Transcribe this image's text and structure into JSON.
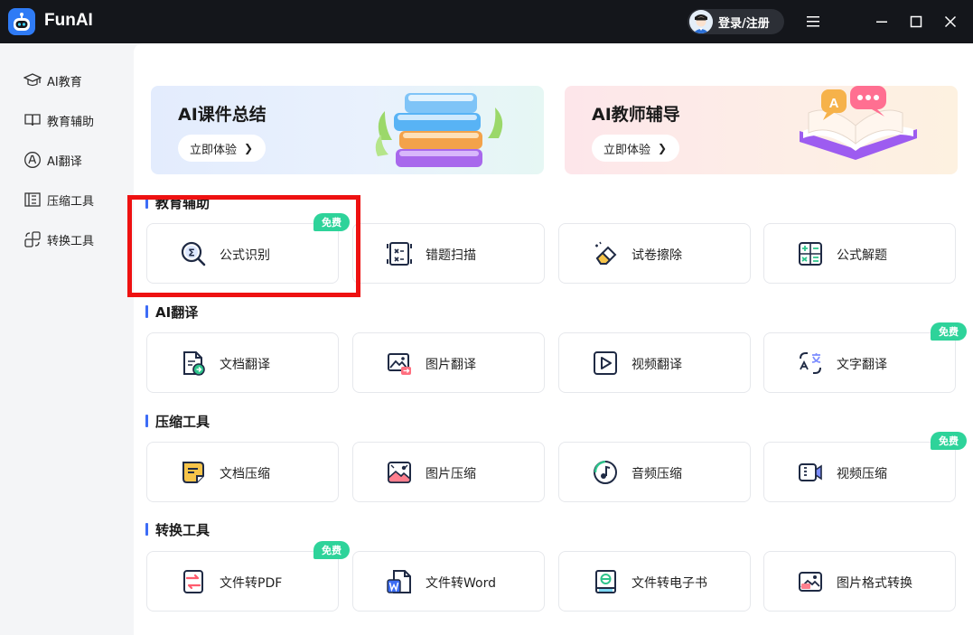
{
  "app": {
    "title": "FunAI"
  },
  "header": {
    "login_label": "登录/注册"
  },
  "sidebar": {
    "items": [
      {
        "label": "AI教育",
        "icon": "graduation-cap-icon"
      },
      {
        "label": "教育辅助",
        "icon": "book-icon"
      },
      {
        "label": "AI翻译",
        "icon": "translate-icon"
      },
      {
        "label": "压缩工具",
        "icon": "compress-icon"
      },
      {
        "label": "转换工具",
        "icon": "convert-icon"
      }
    ]
  },
  "banners": [
    {
      "title": "AI课件总结",
      "button": "立即体验"
    },
    {
      "title": "AI教师辅导",
      "button": "立即体验"
    }
  ],
  "sections": [
    {
      "title": "教育辅助",
      "cards": [
        {
          "label": "公式识别",
          "icon": "formula-search-icon",
          "badge": "免费"
        },
        {
          "label": "错题扫描",
          "icon": "scan-icon"
        },
        {
          "label": "试卷擦除",
          "icon": "eraser-icon"
        },
        {
          "label": "公式解题",
          "icon": "calculator-icon"
        }
      ]
    },
    {
      "title": "AI翻译",
      "cards": [
        {
          "label": "文档翻译",
          "icon": "document-translate-icon"
        },
        {
          "label": "图片翻译",
          "icon": "image-translate-icon"
        },
        {
          "label": "视频翻译",
          "icon": "video-translate-icon"
        },
        {
          "label": "文字翻译",
          "icon": "text-translate-icon",
          "badge": "免费"
        }
      ]
    },
    {
      "title": "压缩工具",
      "cards": [
        {
          "label": "文档压缩",
          "icon": "document-compress-icon"
        },
        {
          "label": "图片压缩",
          "icon": "image-compress-icon"
        },
        {
          "label": "音频压缩",
          "icon": "audio-compress-icon"
        },
        {
          "label": "视频压缩",
          "icon": "video-compress-icon",
          "badge": "免费"
        }
      ]
    },
    {
      "title": "转换工具",
      "cards": [
        {
          "label": "文件转PDF",
          "icon": "pdf-convert-icon",
          "badge": "免费"
        },
        {
          "label": "文件转Word",
          "icon": "word-convert-icon"
        },
        {
          "label": "文件转电子书",
          "icon": "ebook-convert-icon"
        },
        {
          "label": "图片格式转换",
          "icon": "image-format-icon"
        }
      ]
    }
  ],
  "colors": {
    "accent": "#3d6cf6",
    "badge": "#2ed39a",
    "highlight": "#ee1111",
    "titlebar": "#14161b"
  }
}
